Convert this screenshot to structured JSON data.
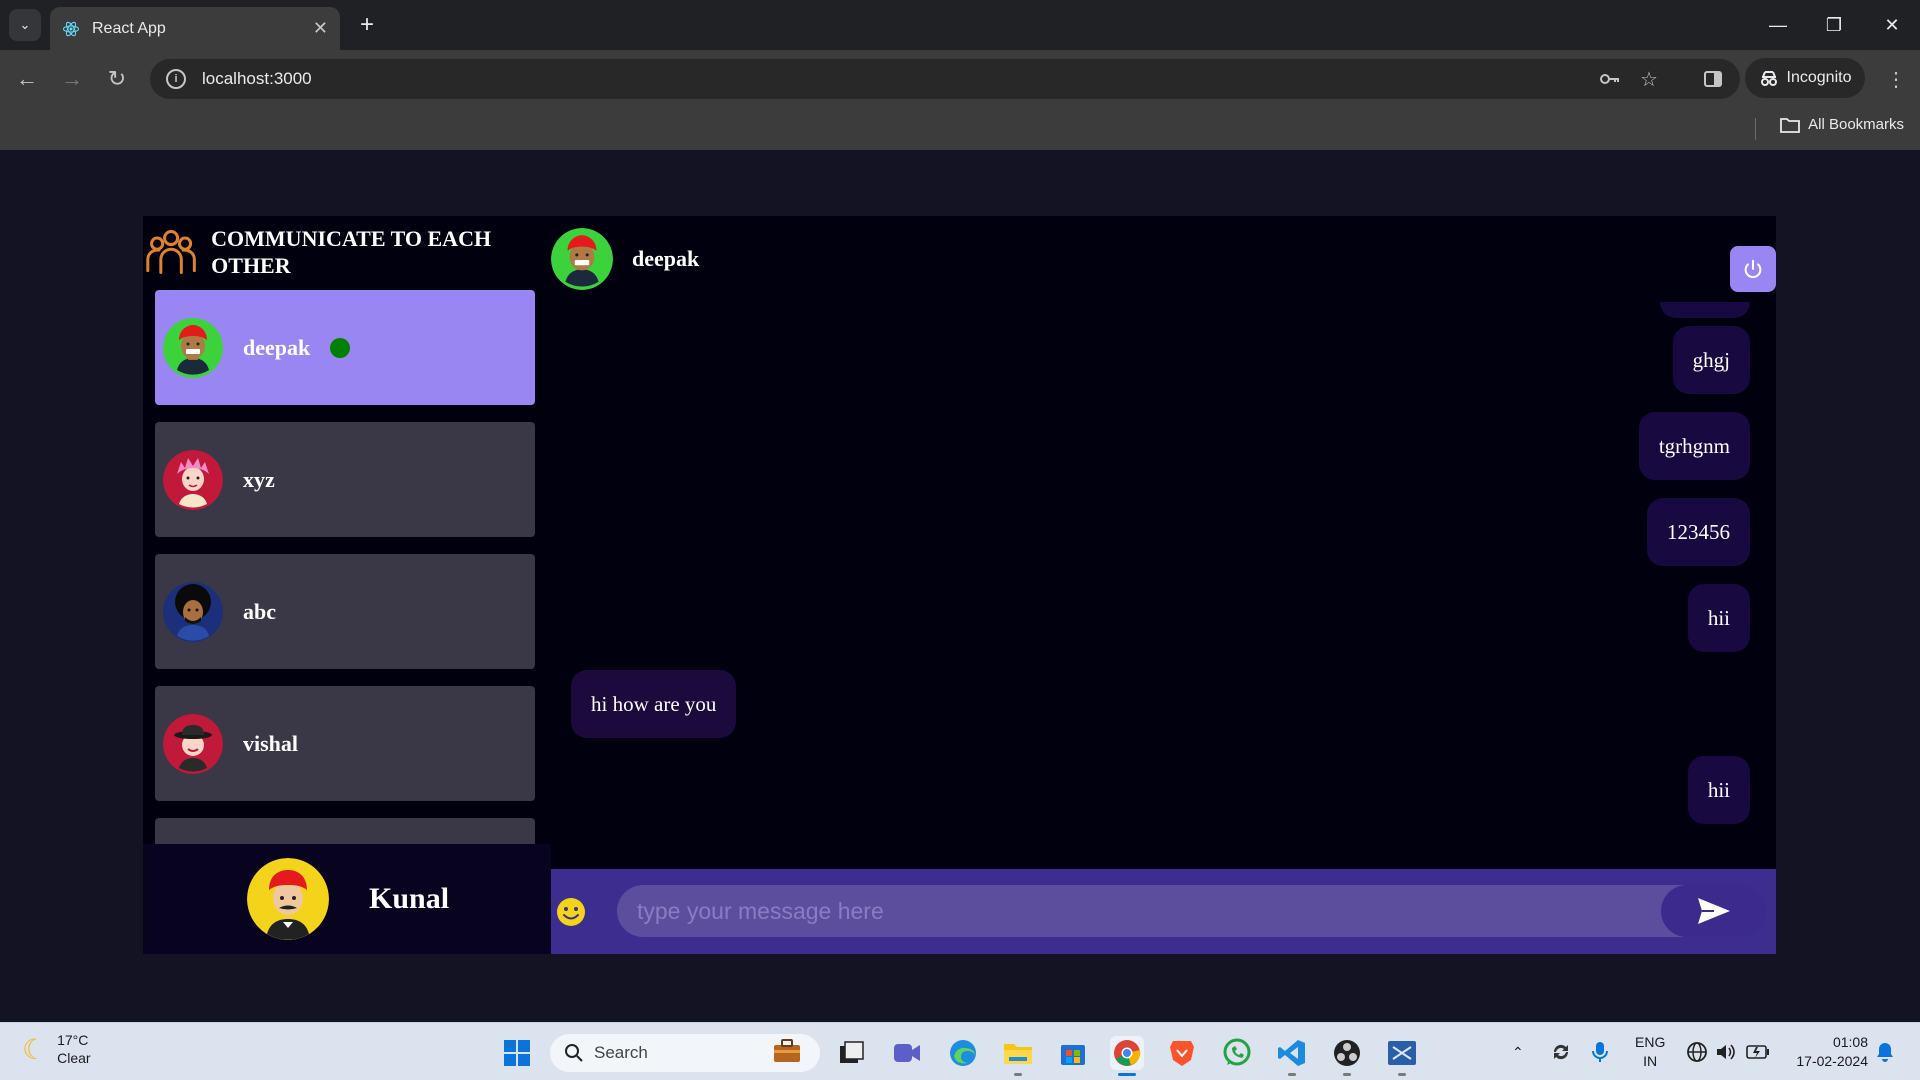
{
  "browser": {
    "tab_title": "React App",
    "url": "localhost:3000",
    "incognito_label": "Incognito",
    "all_bookmarks_label": "All Bookmarks"
  },
  "app": {
    "brand_title": "COMMUNICATE TO EACH OTHER",
    "contacts": [
      {
        "name": "deepak",
        "selected": true,
        "online": true
      },
      {
        "name": "xyz",
        "selected": false,
        "online": false
      },
      {
        "name": "abc",
        "selected": false,
        "online": false
      },
      {
        "name": "vishal",
        "selected": false,
        "online": false
      }
    ],
    "current_user": {
      "name": "Kunal"
    },
    "chat": {
      "header_name": "deepak",
      "messages": [
        {
          "text": "ghgj",
          "direction": "sent"
        },
        {
          "text": "tgrhgnm",
          "direction": "sent"
        },
        {
          "text": "123456",
          "direction": "sent"
        },
        {
          "text": "hii",
          "direction": "sent"
        },
        {
          "text": "hi how are you",
          "direction": "received"
        },
        {
          "text": "hii",
          "direction": "sent"
        }
      ],
      "input_placeholder": "type your message here"
    },
    "colors": {
      "accent": "#9a86f3",
      "online": "#008000",
      "input_bar": "#3d2d8e"
    }
  },
  "taskbar": {
    "weather_temp": "17°C",
    "weather_desc": "Clear",
    "search_label": "Search",
    "lang_top": "ENG",
    "lang_bottom": "IN",
    "time": "01:08",
    "date": "17-02-2024"
  }
}
